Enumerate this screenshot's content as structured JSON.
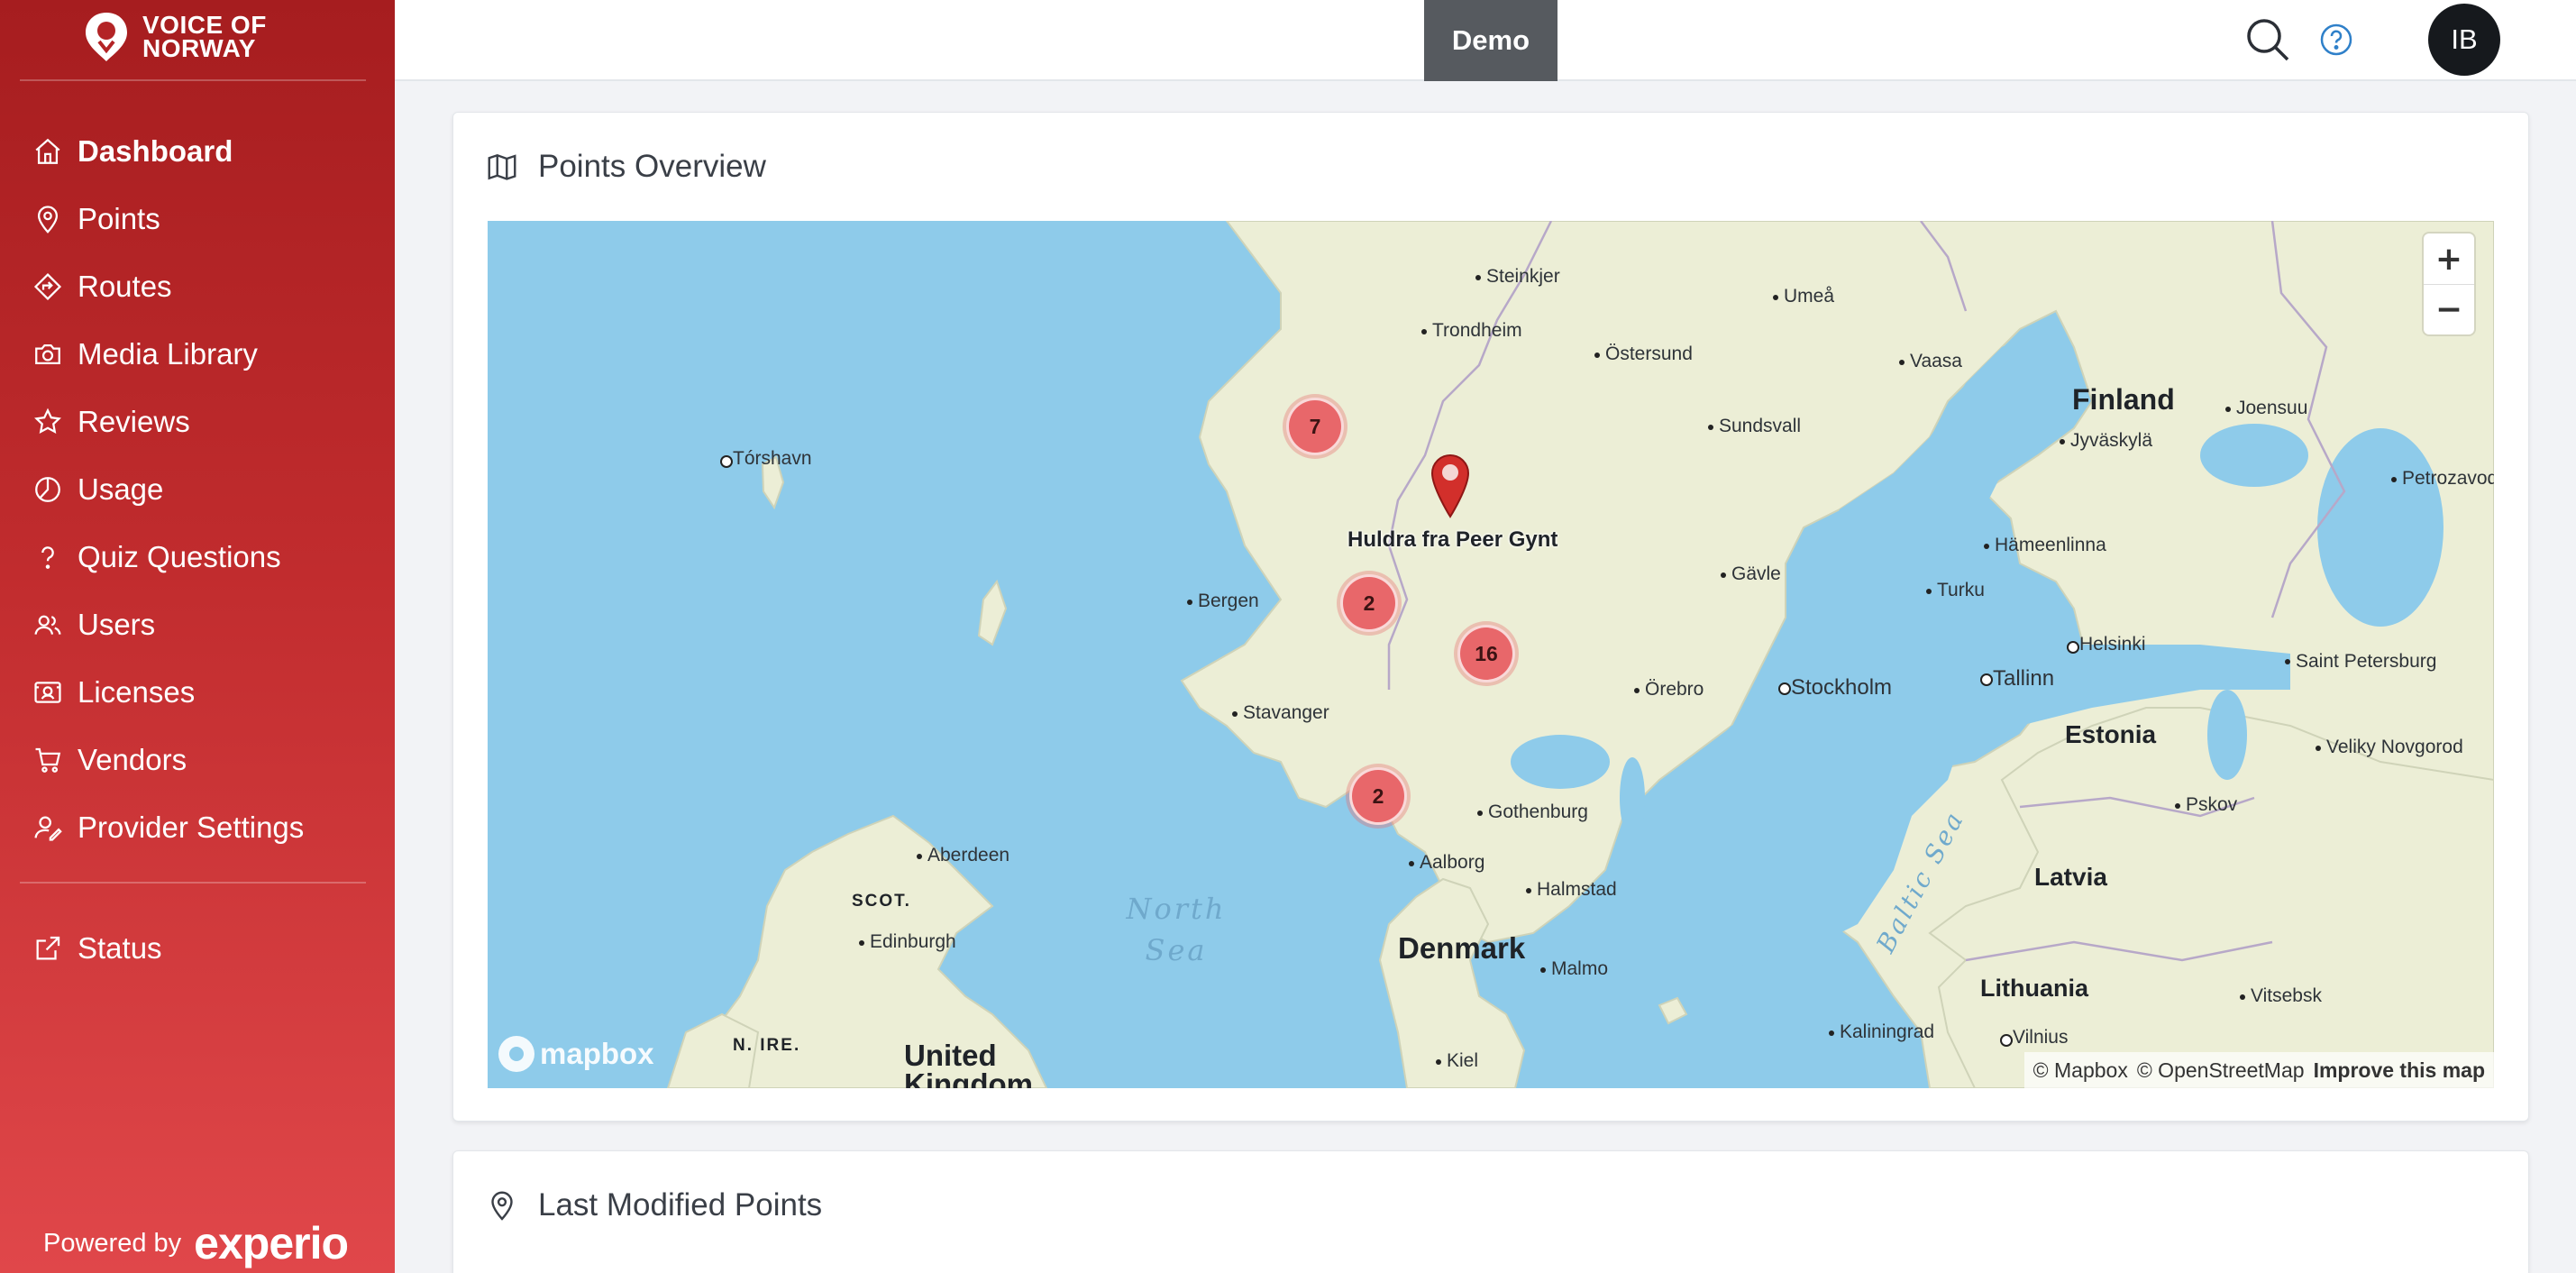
{
  "brand": {
    "name_line1": "VOICE OF",
    "name_line2": "NORWAY",
    "powered_label": "Powered by",
    "powered_brand": "experio"
  },
  "sidebar": {
    "items": [
      {
        "label": "Dashboard",
        "icon": "home-icon"
      },
      {
        "label": "Points",
        "icon": "map-pin-icon"
      },
      {
        "label": "Routes",
        "icon": "route-icon"
      },
      {
        "label": "Media Library",
        "icon": "camera-icon"
      },
      {
        "label": "Reviews",
        "icon": "star-icon"
      },
      {
        "label": "Usage",
        "icon": "pie-chart-icon"
      },
      {
        "label": "Quiz Questions",
        "icon": "question-icon"
      },
      {
        "label": "Users",
        "icon": "users-icon"
      },
      {
        "label": "Licenses",
        "icon": "license-icon"
      },
      {
        "label": "Vendors",
        "icon": "cart-icon"
      },
      {
        "label": "Provider Settings",
        "icon": "user-settings-icon"
      }
    ],
    "status": {
      "label": "Status",
      "icon": "external-link-icon"
    }
  },
  "topbar": {
    "environment": "Demo",
    "avatar_initials": "IB"
  },
  "cards": {
    "points_overview": {
      "title": "Points Overview"
    },
    "last_modified": {
      "title": "Last Modified Points"
    }
  },
  "map": {
    "clusters": [
      "7",
      "2",
      "16",
      "2"
    ],
    "marker_label": "Huldra fra Peer Gynt",
    "cities": [
      "Steinkjer",
      "Trondheim",
      "Umeå",
      "Östersund",
      "Vaasa",
      "Joensuu",
      "Tórshavn",
      "Sundsvall",
      "Jyväskylä",
      "Petrozavodsk",
      "Hämeenlinna",
      "Gävle",
      "Bergen",
      "Turku",
      "Helsinki",
      "Saint Petersburg",
      "Stockholm",
      "Tallinn",
      "Örebro",
      "Stavanger",
      "Veliky Novgorod",
      "Gothenburg",
      "Pskov",
      "Aberdeen",
      "Aalborg",
      "Halmstad",
      "Edinburgh",
      "Malmo",
      "Kaliningrad",
      "Vilnius",
      "Vitsebsk",
      "Kiel"
    ],
    "countries": [
      "Finland",
      "Estonia",
      "Latvia",
      "Lithuania",
      "Denmark",
      "SCOT.",
      "N. IRE.",
      "United Kingdom"
    ],
    "seas": [
      "North Sea",
      "Baltic Sea"
    ],
    "mapbox_logo": "mapbox",
    "attribution": {
      "mapbox": "© Mapbox",
      "osm": "© OpenStreetMap",
      "improve": "Improve this map"
    },
    "zoom_in": "+",
    "zoom_out": "−"
  },
  "colors": {
    "sidebar_top": "#a61d1f",
    "sidebar_bottom": "#e0474a",
    "cluster": "#e8676a",
    "badge": "#565a5f",
    "water": "#8ecbea",
    "land": "#eeeed6"
  }
}
